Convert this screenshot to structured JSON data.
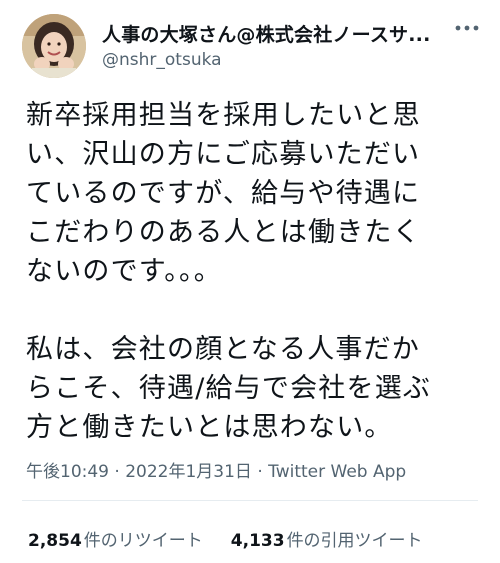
{
  "author": {
    "display_name": "人事の大塚さん@株式会社ノースサ...",
    "handle": "@nshr_otsuka",
    "avatar": "avatar-photo"
  },
  "more_icon": "more-horizontal-icon",
  "tweet_text_lines": [
    "新卒採用担当を採用したいと思",
    "い、沢山の方にご応募いただい",
    "ているのですが、給与や待遇に",
    "こだわりのある人とは働きたく",
    "ないのです。。。",
    "",
    "私は、会社の顔となる人事だか",
    "らこそ、待遇/給与で会社を選ぶ",
    "方と働きたいとは思わない。"
  ],
  "meta": {
    "time": "午後10:49",
    "separator1": " · ",
    "date": "2022年1月31日",
    "separator2": " · ",
    "source": "Twitter Web App"
  },
  "stats": {
    "retweets_count": "2,854",
    "retweets_label": "件のリツイート",
    "quotes_count": "4,133",
    "quotes_label": "件の引用ツイート"
  },
  "colors": {
    "text": "#0f1419",
    "secondary": "#536471",
    "divider": "#e6ecf0"
  }
}
